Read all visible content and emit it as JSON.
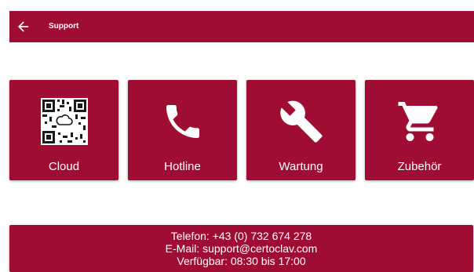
{
  "header": {
    "title": "Support",
    "back_icon": "arrow-left-icon"
  },
  "tiles": [
    {
      "label": "Cloud",
      "icon": "qr-code-icon"
    },
    {
      "label": "Hotline",
      "icon": "phone-icon"
    },
    {
      "label": "Wartung",
      "icon": "wrench-icon"
    },
    {
      "label": "Zubehör",
      "icon": "shopping-cart-icon"
    }
  ],
  "contact": {
    "phone_line": "Telefon: +43 (0) 732 674 278",
    "email_line": "E-Mail: support@certoclav.com",
    "hours_line": "Verfügbar: 08:30 bis 17:00"
  },
  "colors": {
    "brand": "#a00d33",
    "text_on_brand": "#ffffff",
    "background": "#ffffff"
  }
}
